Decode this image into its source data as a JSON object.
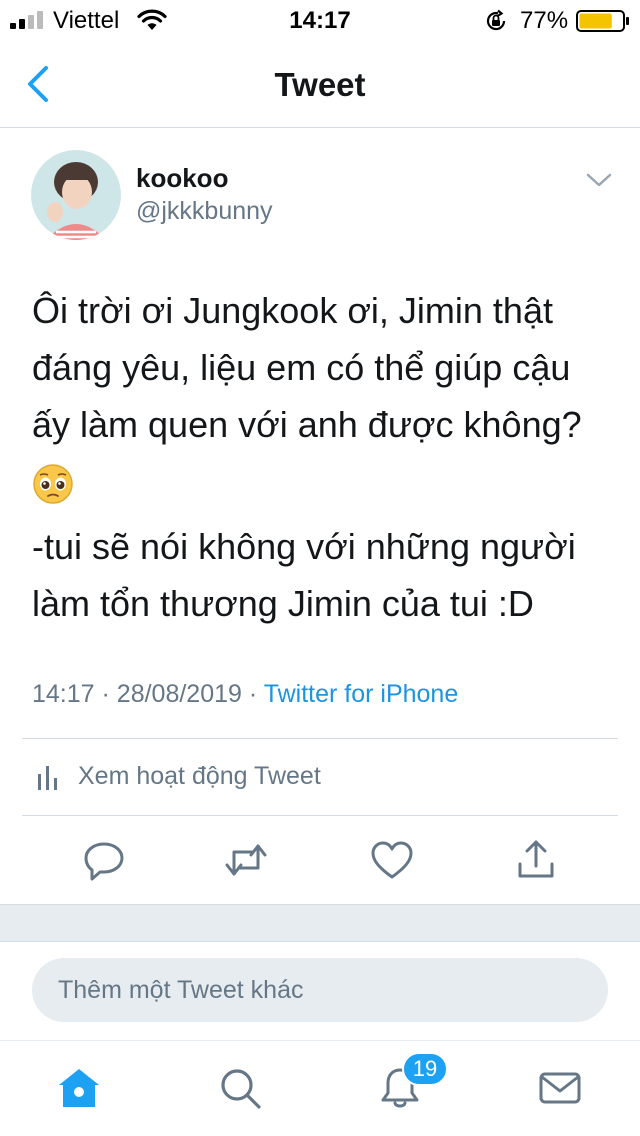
{
  "status_bar": {
    "carrier": "Viettel",
    "time": "14:17",
    "battery_percent": "77%",
    "battery_level": 0.77,
    "icons": [
      "signal-icon",
      "wifi-icon",
      "orientation-lock-icon",
      "battery-icon"
    ]
  },
  "nav": {
    "title": "Tweet",
    "back_icon": "chevron-left-icon"
  },
  "tweet": {
    "display_name": "kookoo",
    "handle": "@jkkkbunny",
    "text_lines": [
      "Ôi trời ơi Jungkook ơi, Jimin thật",
      "đáng yêu, liệu em có thể giúp cậu",
      "ấy làm quen với anh được không?"
    ],
    "emoji": "pleading-face-emoji",
    "reply_lines": [
      "-tui sẽ nói không với những người",
      "làm tổn thương Jimin của tui :D"
    ],
    "time": "14:17",
    "date": "28/08/2019",
    "separator": "·",
    "source": "Twitter for iPhone",
    "activity_label": "Xem hoạt động Tweet"
  },
  "actions": [
    {
      "name": "reply",
      "icon": "reply-icon"
    },
    {
      "name": "retweet",
      "icon": "retweet-icon"
    },
    {
      "name": "like",
      "icon": "heart-icon"
    },
    {
      "name": "share",
      "icon": "share-icon"
    }
  ],
  "compose": {
    "placeholder": "Thêm một Tweet khác"
  },
  "tabbar": {
    "items": [
      {
        "name": "home",
        "icon": "home-icon",
        "active": true
      },
      {
        "name": "search",
        "icon": "search-icon",
        "active": false
      },
      {
        "name": "notifications",
        "icon": "bell-icon",
        "active": false
      },
      {
        "name": "messages",
        "icon": "mail-icon",
        "active": false
      }
    ],
    "notification_count": "19"
  },
  "colors": {
    "accent": "#1da1f2",
    "link": "#1b95e0",
    "text": "#14171a",
    "secondary_text": "#657786",
    "divider": "#d5dce1",
    "band": "#e6ecf0",
    "battery": "#f5c400"
  }
}
